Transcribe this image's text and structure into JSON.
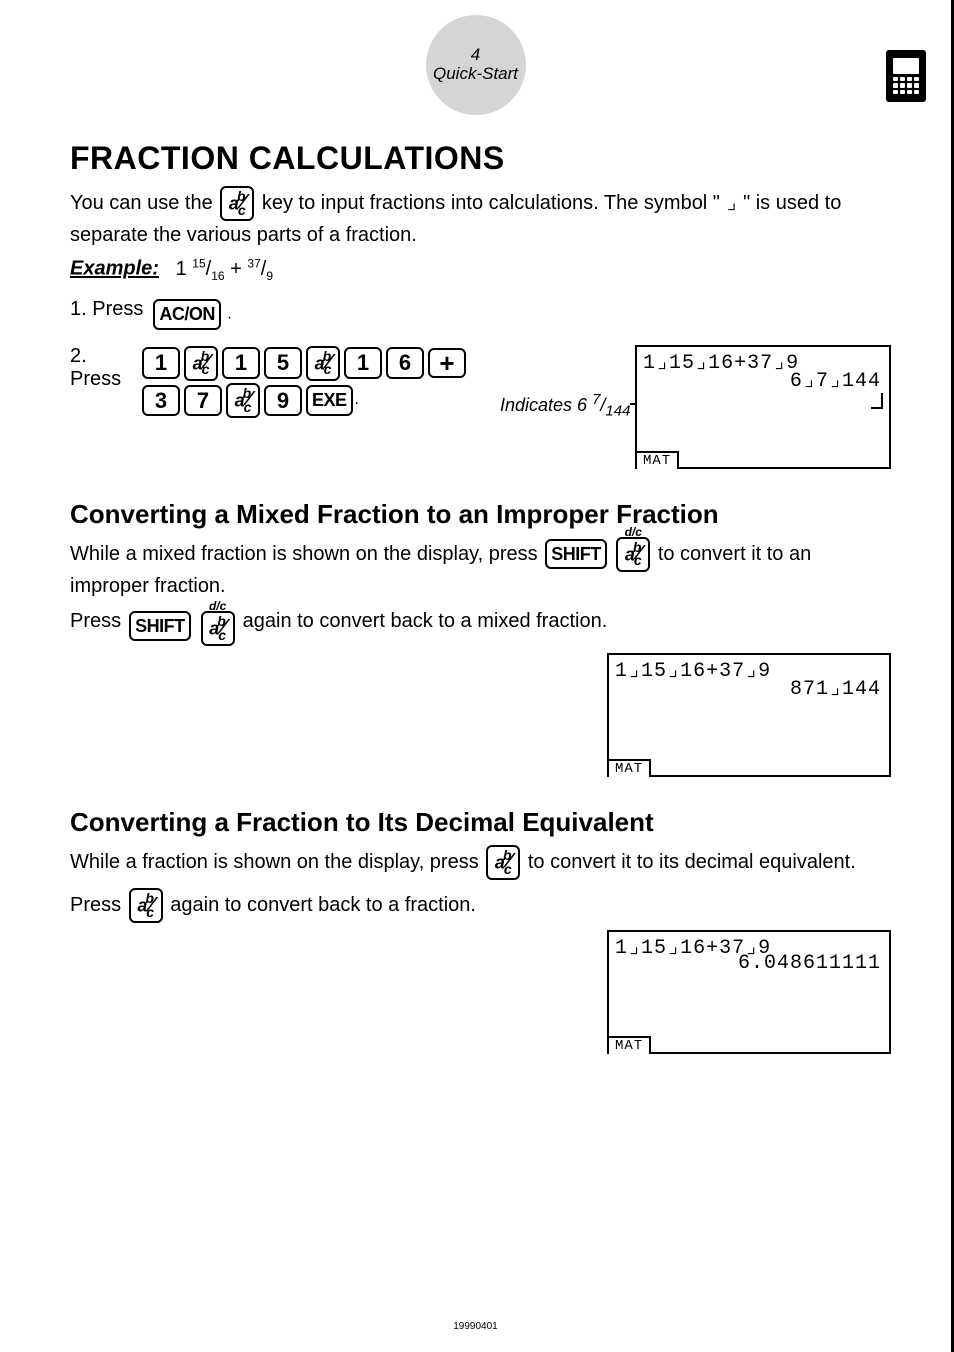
{
  "header": {
    "page_num": "4",
    "section": "Quick-Start"
  },
  "title": "FRACTION CALCULATIONS",
  "intro_pre": "You can use the ",
  "intro_post": " key to input fractions into calculations. The symbol \" ",
  "intro_sym": "⌟",
  "intro_end": " \" is used to separate the various parts of a fraction.",
  "example_label": "Example:",
  "example_mf_whole": "1",
  "example_mf_num": "15",
  "example_mf_den": "16",
  "example_plus": " + ",
  "example_f2_num": "37",
  "example_f2_den": "9",
  "step1_label": "1.  Press ",
  "step2_label": "2.  Press ",
  "key_acon": "AC/ON",
  "key_shift": "SHIFT",
  "key_exe": "EXE",
  "key_plus": "+",
  "digits": {
    "d1": "1",
    "d5": "5",
    "d6": "6",
    "d3": "3",
    "d7": "7",
    "d9": "9"
  },
  "indicates_pre": "Indicates 6 ",
  "indicates_num": "7",
  "indicates_den": "144",
  "display1": {
    "line1": "1⌟15⌟16+37⌟9",
    "line2": "6⌟7⌟144",
    "tab": "MAT"
  },
  "h2_mixed": "Converting a Mixed Fraction to an Improper Fraction",
  "mixed_p1_pre": "While a mixed fraction is shown on the display, press ",
  "mixed_p1_post": " to convert it to an improper fraction.",
  "mixed_p2_pre": "Press ",
  "mixed_p2_post": " again to convert back to a mixed fraction.",
  "display2": {
    "line1": "1⌟15⌟16+37⌟9",
    "line2": "871⌟144",
    "tab": "MAT"
  },
  "h2_dec": "Converting a Fraction to Its Decimal Equivalent",
  "dec_p1_pre": "While a fraction is shown on the display, press ",
  "dec_p1_post": " to convert it to its decimal equivalent.",
  "dec_p2_pre": "Press ",
  "dec_p2_post": " again to convert back to a fraction.",
  "display3": {
    "line1": "1⌟15⌟16+37⌟9",
    "line2": "6.048611111",
    "tab": "MAT"
  },
  "footer": "19990401"
}
